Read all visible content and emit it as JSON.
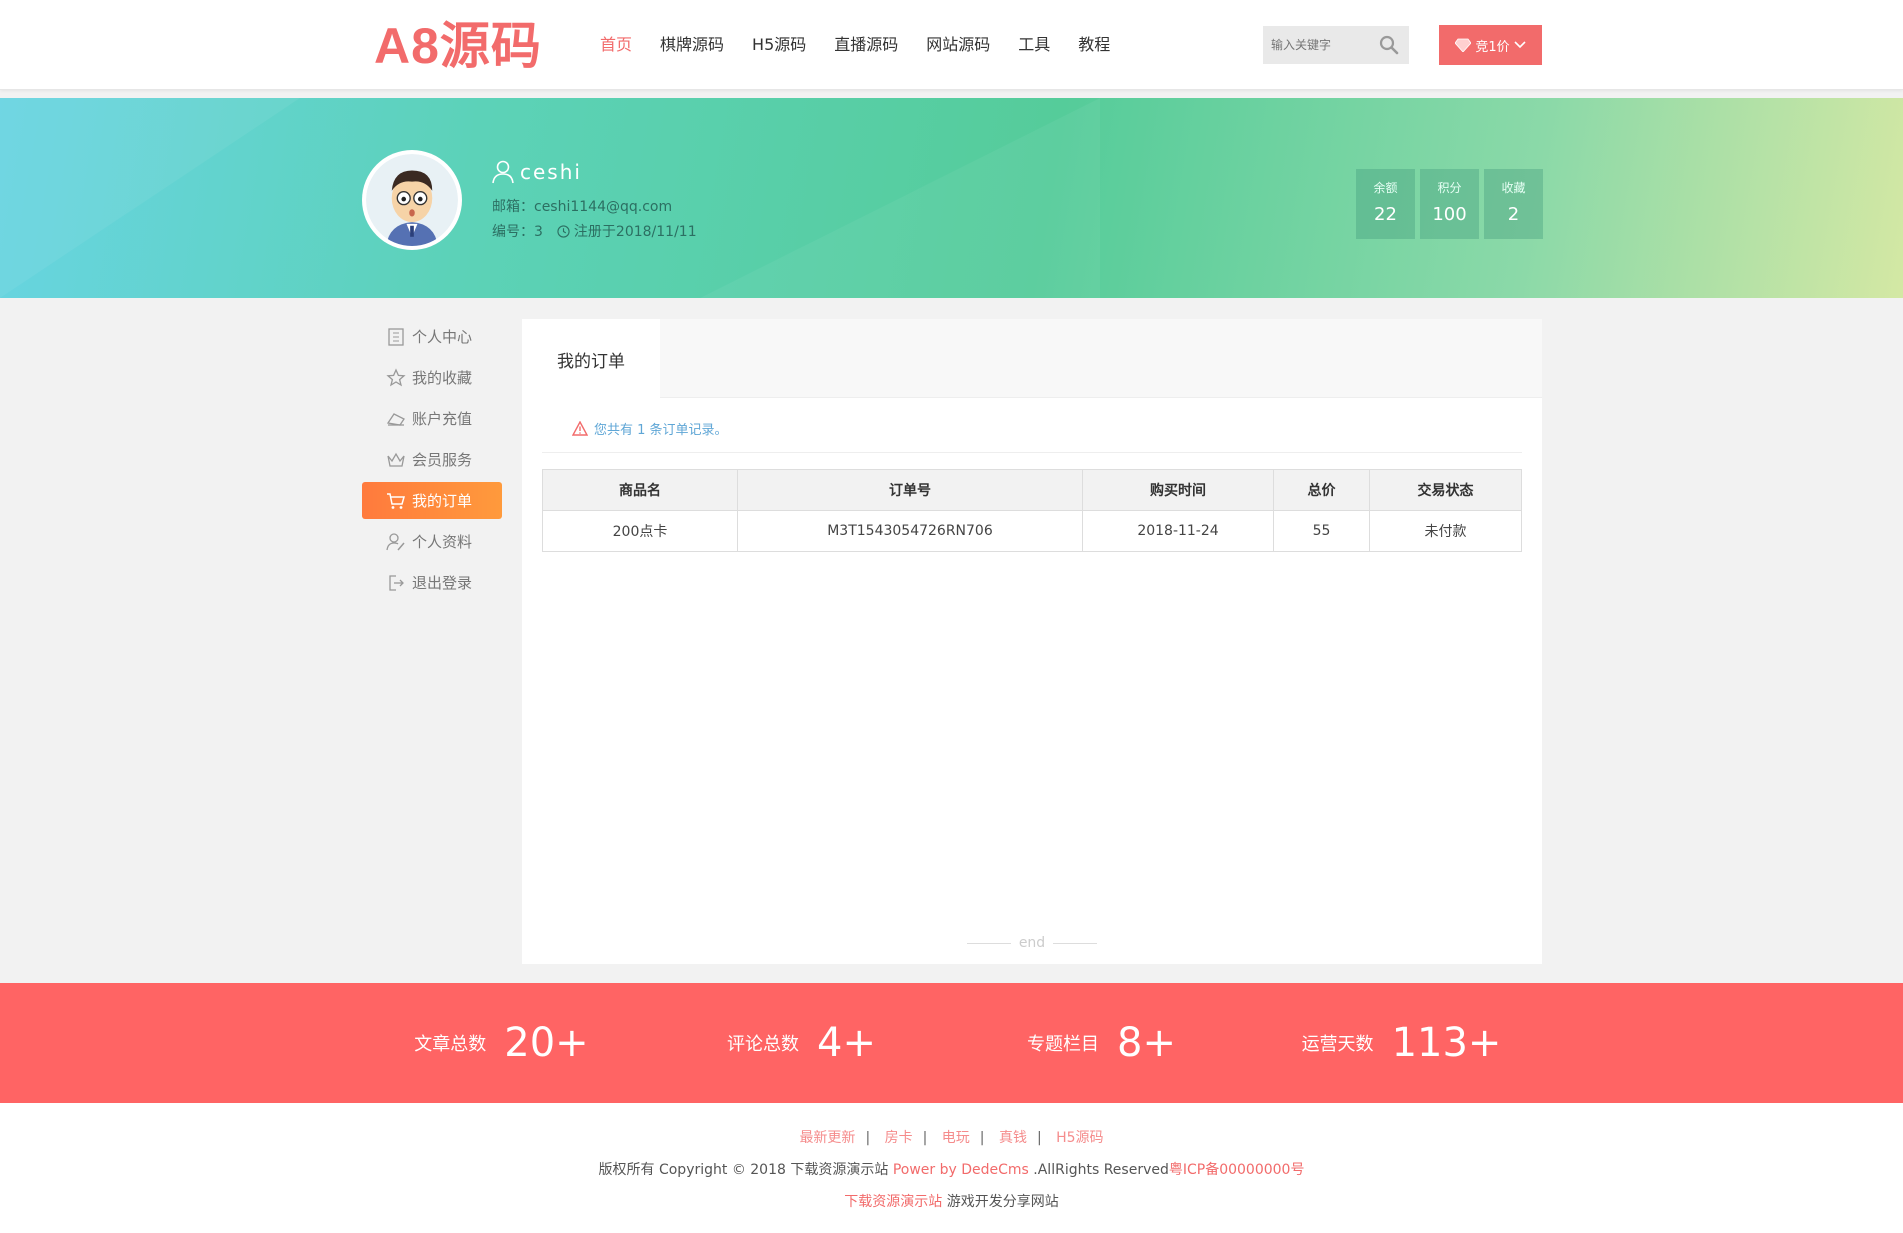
{
  "header": {
    "logo": "A8源码",
    "nav": [
      "首页",
      "棋牌源码",
      "H5源码",
      "直播源码",
      "网站源码",
      "工具",
      "教程"
    ],
    "search_placeholder": "输入关键字",
    "bid_label": "竞1价"
  },
  "profile": {
    "username": "ceshi",
    "email": "邮箱：ceshi1144@qq.com",
    "id": "编号：3",
    "registered": "注册于2018/11/11",
    "stats": [
      {
        "label": "余额",
        "value": "22"
      },
      {
        "label": "积分",
        "value": "100"
      },
      {
        "label": "收藏",
        "value": "2"
      }
    ]
  },
  "sidebar": {
    "items": [
      {
        "label": "个人中心",
        "icon": "building-icon"
      },
      {
        "label": "我的收藏",
        "icon": "star-icon"
      },
      {
        "label": "账户充值",
        "icon": "wallet-icon"
      },
      {
        "label": "会员服务",
        "icon": "crown-icon"
      },
      {
        "label": "我的订单",
        "icon": "cart-icon"
      },
      {
        "label": "个人资料",
        "icon": "user-edit-icon"
      },
      {
        "label": "退出登录",
        "icon": "logout-icon"
      }
    ],
    "active_index": 4
  },
  "main": {
    "tab": "我的订单",
    "notice": "您共有 1 条订单记录。",
    "table": {
      "headers": [
        "商品名",
        "订单号",
        "购买时间",
        "总价",
        "交易状态"
      ],
      "rows": [
        [
          "200点卡",
          "M3T1543054726RN706",
          "2018-11-24",
          "55",
          "未付款"
        ]
      ]
    },
    "end_label": "end"
  },
  "statsbar": [
    {
      "label": "文章总数",
      "value": "20+"
    },
    {
      "label": "评论总数",
      "value": "4+"
    },
    {
      "label": "专题栏目",
      "value": "8+"
    },
    {
      "label": "运营天数",
      "value": "113+"
    }
  ],
  "footer": {
    "links": [
      "最新更新",
      "房卡",
      "电玩",
      "真钱",
      "H5源码"
    ],
    "copyright": "版权所有 Copyright © 2018 下载资源演示站 ",
    "power": "Power by DedeCms",
    "rights": " .AllRights Reserved",
    "icp": "粤ICP备00000000号",
    "site": "下载资源演示站",
    "tagline": " 游戏开发分享网站"
  },
  "colors": {
    "accent": "#f26b6b",
    "active_menu": "#ff8a3c",
    "stats_bar": "#ff6464"
  }
}
